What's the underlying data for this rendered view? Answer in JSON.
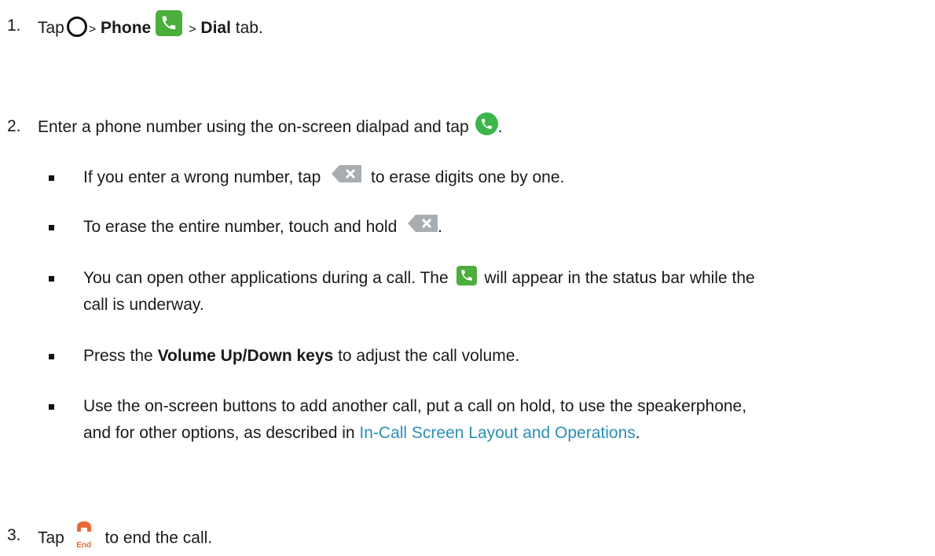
{
  "step1": {
    "number": "1.",
    "tap": "Tap",
    "sep1": ">",
    "phone": "Phone",
    "sep2": ">",
    "dial": "Dial",
    "tab": "tab."
  },
  "step2": {
    "number": "2.",
    "text": "Enter a phone number using the on-screen dialpad and tap",
    "end": "."
  },
  "bullets": {
    "b1_pre": "If you enter a wrong number, tap",
    "b1_post": "to erase digits one by one.",
    "b2_pre": "To erase the entire number, touch and hold",
    "b2_post": ".",
    "b3_pre": "You can open other applications during a call. The",
    "b3_post": "will appear in the status bar while the",
    "b3_line2": "call is underway.",
    "b4_pre": "Press the",
    "b4_bold": "Volume Up/Down keys",
    "b4_post": "to adjust the call volume.",
    "b5_line1": "Use the on-screen buttons to add another call, put a call on hold, to use the speakerphone,",
    "b5_line2_pre": "and for other options, as described in",
    "b5_link": "In-Call Screen Layout and Operations",
    "b5_line2_post": "."
  },
  "step3": {
    "number": "3.",
    "tap": "Tap",
    "end_label": "End",
    "text": "to end the call."
  },
  "icons": {
    "home": "home-circle-icon",
    "phone_app": "phone-app-icon",
    "call": "call-button-icon",
    "backspace": "backspace-icon",
    "end_call": "end-call-icon"
  },
  "colors": {
    "phone_green": "#4cae3b",
    "backspace_gray": "#a7adb0",
    "end_orange": "#e66a35",
    "link_blue": "#2b8fb8"
  }
}
